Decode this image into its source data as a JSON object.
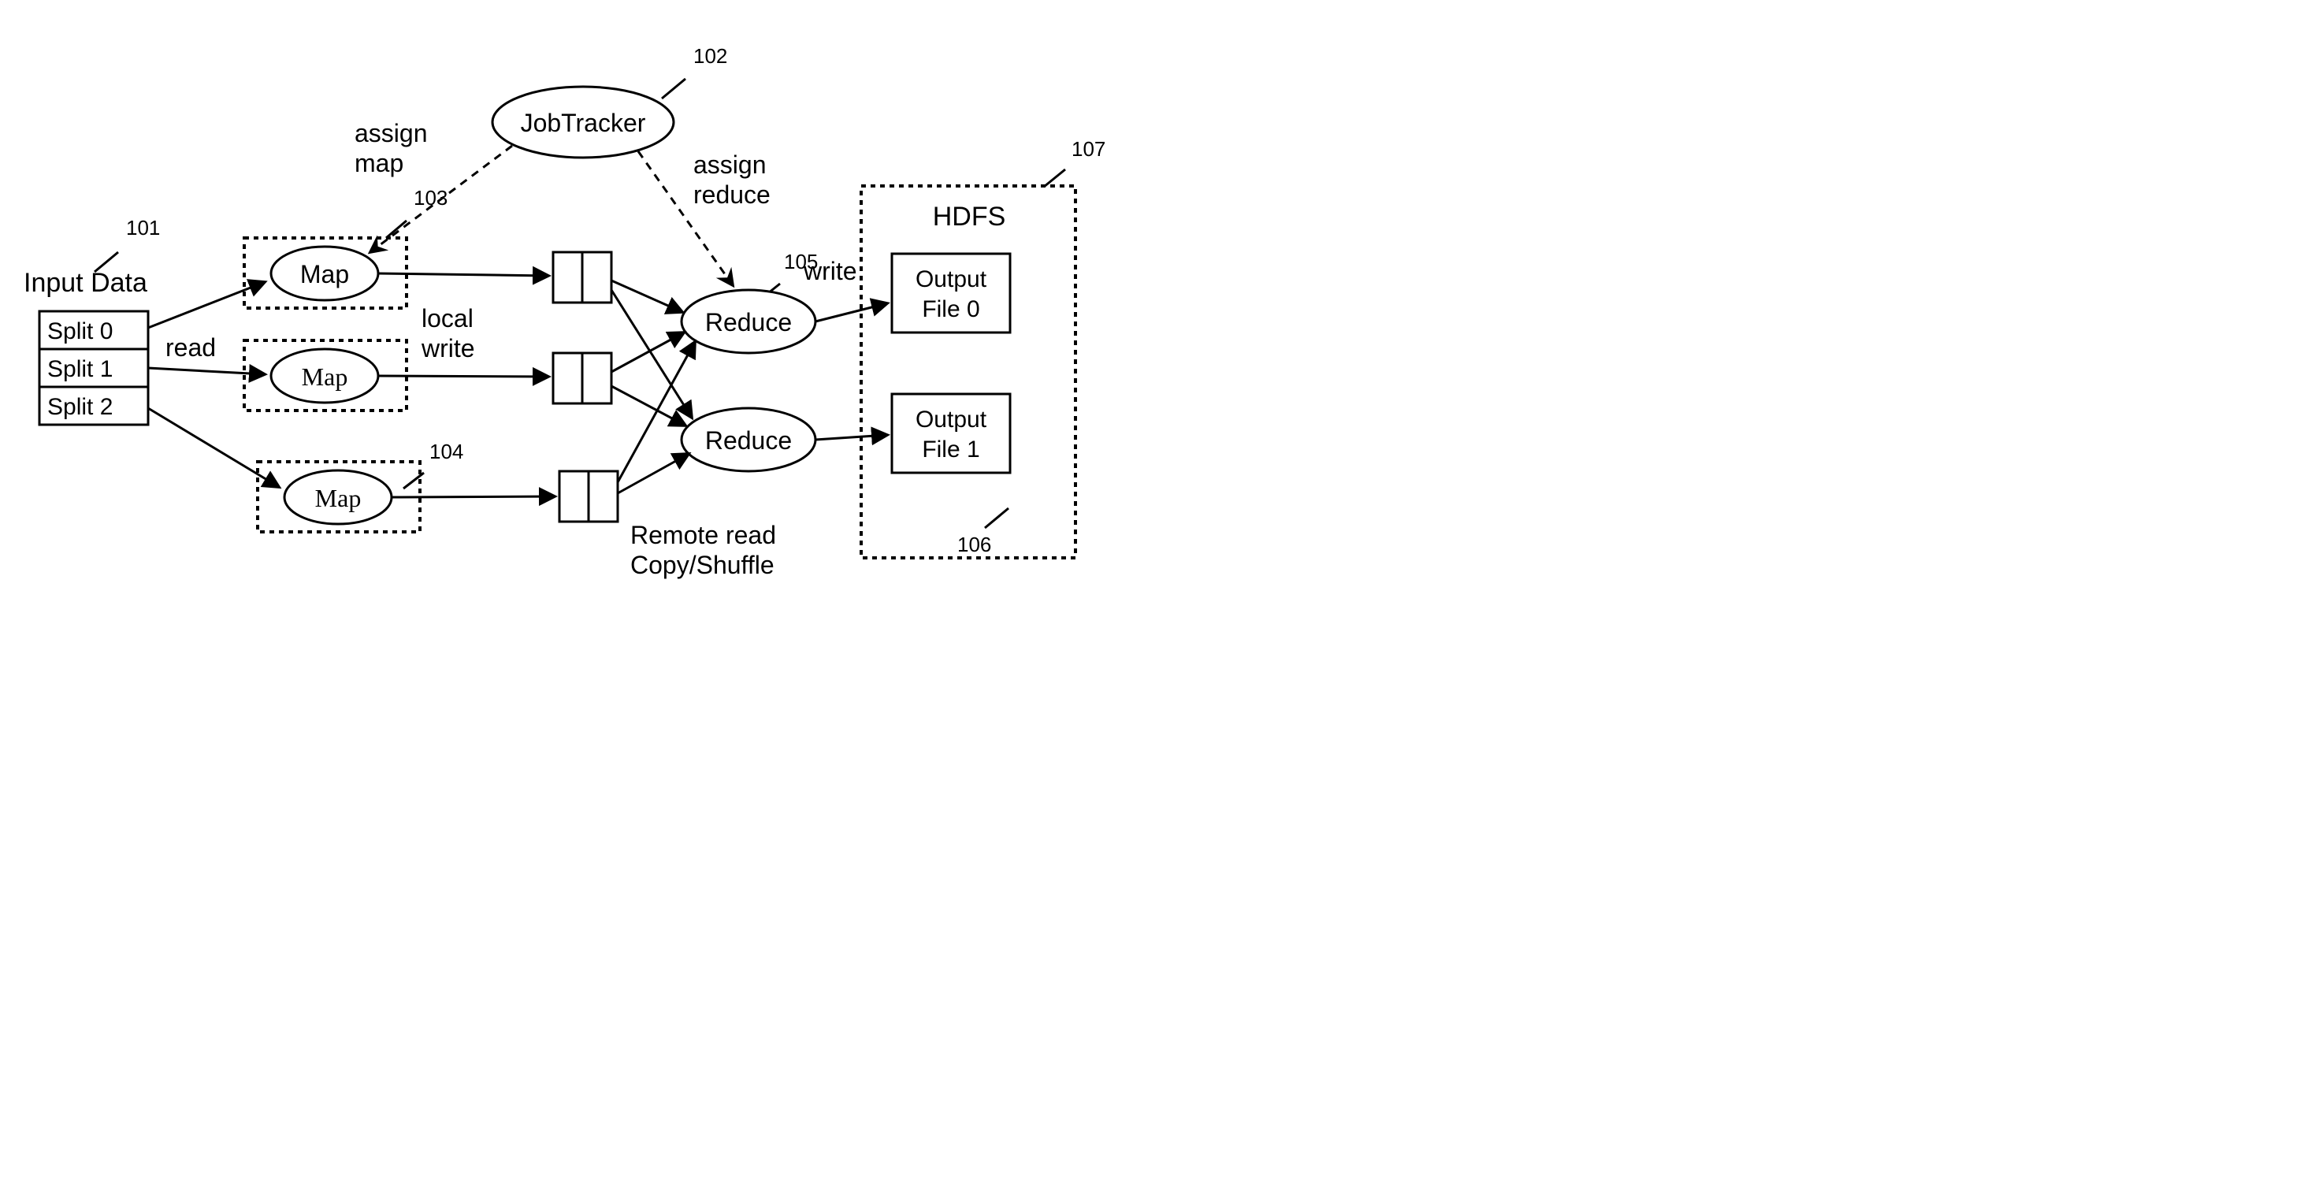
{
  "refs": {
    "r101": "101",
    "r102": "102",
    "r103": "103",
    "r104": "104",
    "r105": "105",
    "r106": "106",
    "r107": "107"
  },
  "labels": {
    "input_data": "Input Data",
    "split0": "Split 0",
    "split1": "Split 1",
    "split2": "Split 2",
    "jobtracker": "JobTracker",
    "map1": "Map",
    "map2": "Map",
    "map3": "Map",
    "reduce1": "Reduce",
    "reduce2": "Reduce",
    "hdfs": "HDFS",
    "output0_l1": "Output",
    "output0_l2": "File 0",
    "output1_l1": "Output",
    "output1_l2": "File 1",
    "read": "read",
    "assign_map_l1": "assign",
    "assign_map_l2": "map",
    "assign_reduce_l1": "assign",
    "assign_reduce_l2": "reduce",
    "local_write_l1": "local",
    "local_write_l2": "write",
    "write": "write",
    "remote_l1": "Remote read",
    "remote_l2": "Copy/Shuffle"
  }
}
